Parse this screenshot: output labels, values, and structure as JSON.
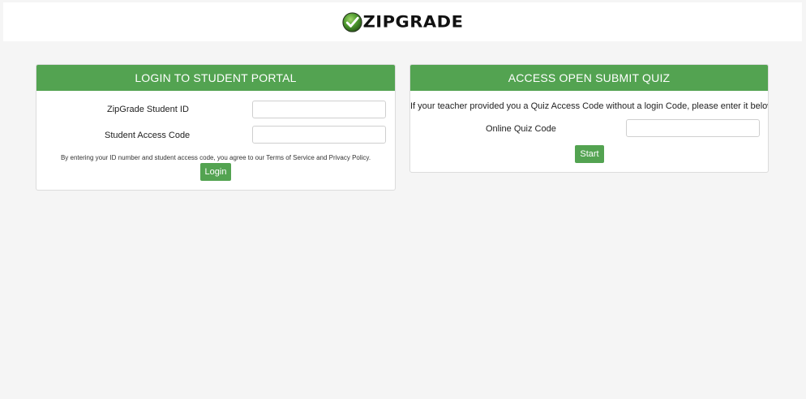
{
  "header": {
    "logo_icon": "check-circle-icon",
    "logo_text": "ZIPGRADE"
  },
  "colors": {
    "accent": "#53a351",
    "background": "#f5f5f5"
  },
  "login": {
    "title": "LOGIN TO STUDENT PORTAL",
    "student_id_label": "ZipGrade Student ID",
    "student_id_value": "",
    "access_code_label": "Student Access Code",
    "access_code_value": "",
    "agreement_text": "By entering your ID number and student access code, you agree to our Terms of Service and Privacy Policy.",
    "login_button": "Login"
  },
  "open_quiz": {
    "title": "ACCESS OPEN SUBMIT QUIZ",
    "instructions": "If your teacher provided you a Quiz Access Code without a login Code, please enter it below:",
    "quiz_code_label": "Online Quiz Code",
    "quiz_code_value": "",
    "start_button": "Start"
  }
}
